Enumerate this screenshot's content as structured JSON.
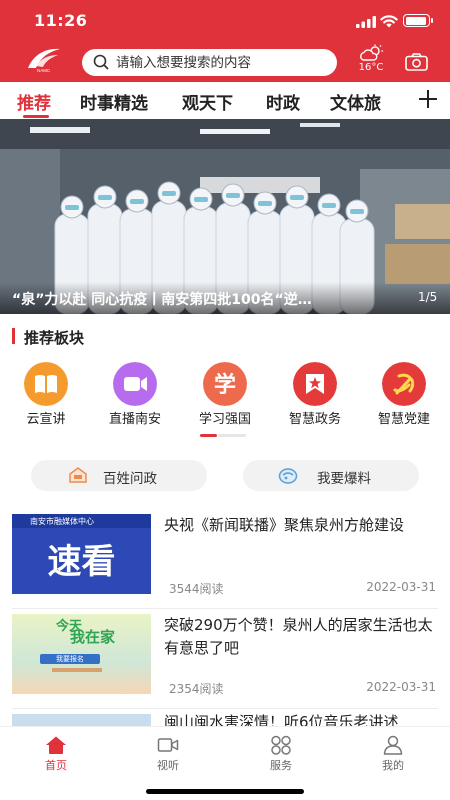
{
  "status_bar": {
    "time": "11:26"
  },
  "header": {
    "search_placeholder": "请输入想要搜索的内容",
    "weather": {
      "icon": "partly-cloudy-icon",
      "temperature": "16°C"
    },
    "brand_color": "#e0323b"
  },
  "channels": [
    {
      "label": "推荐",
      "active": true
    },
    {
      "label": "时事精选"
    },
    {
      "label": "观天下"
    },
    {
      "label": "时政"
    },
    {
      "label": "文体旅"
    }
  ],
  "banner": {
    "title": "“泉”力以赴 同心抗疫丨南安第四批100名“逆…",
    "index": "1/5"
  },
  "section": {
    "title": "推荐板块"
  },
  "features": [
    {
      "label": "云宣讲",
      "icon": "book-icon"
    },
    {
      "label": "直播南安",
      "icon": "video-icon"
    },
    {
      "label": "学习强国",
      "icon": "xue-icon"
    },
    {
      "label": "智慧政务",
      "icon": "star-flag-icon"
    },
    {
      "label": "智慧党建",
      "icon": "party-emblem-icon"
    }
  ],
  "pills": [
    {
      "label": "百姓问政",
      "icon": "ask-icon"
    },
    {
      "label": "我要爆料",
      "icon": "tip-icon"
    }
  ],
  "news": [
    {
      "title": "央视《新闻联播》聚焦泉州方舱建设",
      "reads": "3544阅读",
      "date": "2022-03-31",
      "thumb_header": "南安市融媒体中心",
      "thumb_text": "速看"
    },
    {
      "title": "突破290万个赞！泉州人的居家生活也太有意思了吧",
      "reads": "2354阅读",
      "date": "2022-03-31",
      "thumb_text_top": "今天",
      "thumb_text_main": "我在家",
      "thumb_button": "我要报名"
    },
    {
      "title": "闽山闽水害深情！听6位音乐老讲述"
    }
  ],
  "tabbar": [
    {
      "label": "首页",
      "icon": "home-icon",
      "active": true
    },
    {
      "label": "视听",
      "icon": "video-camera-icon"
    },
    {
      "label": "服务",
      "icon": "grid-icon"
    },
    {
      "label": "我的",
      "icon": "user-icon"
    }
  ]
}
